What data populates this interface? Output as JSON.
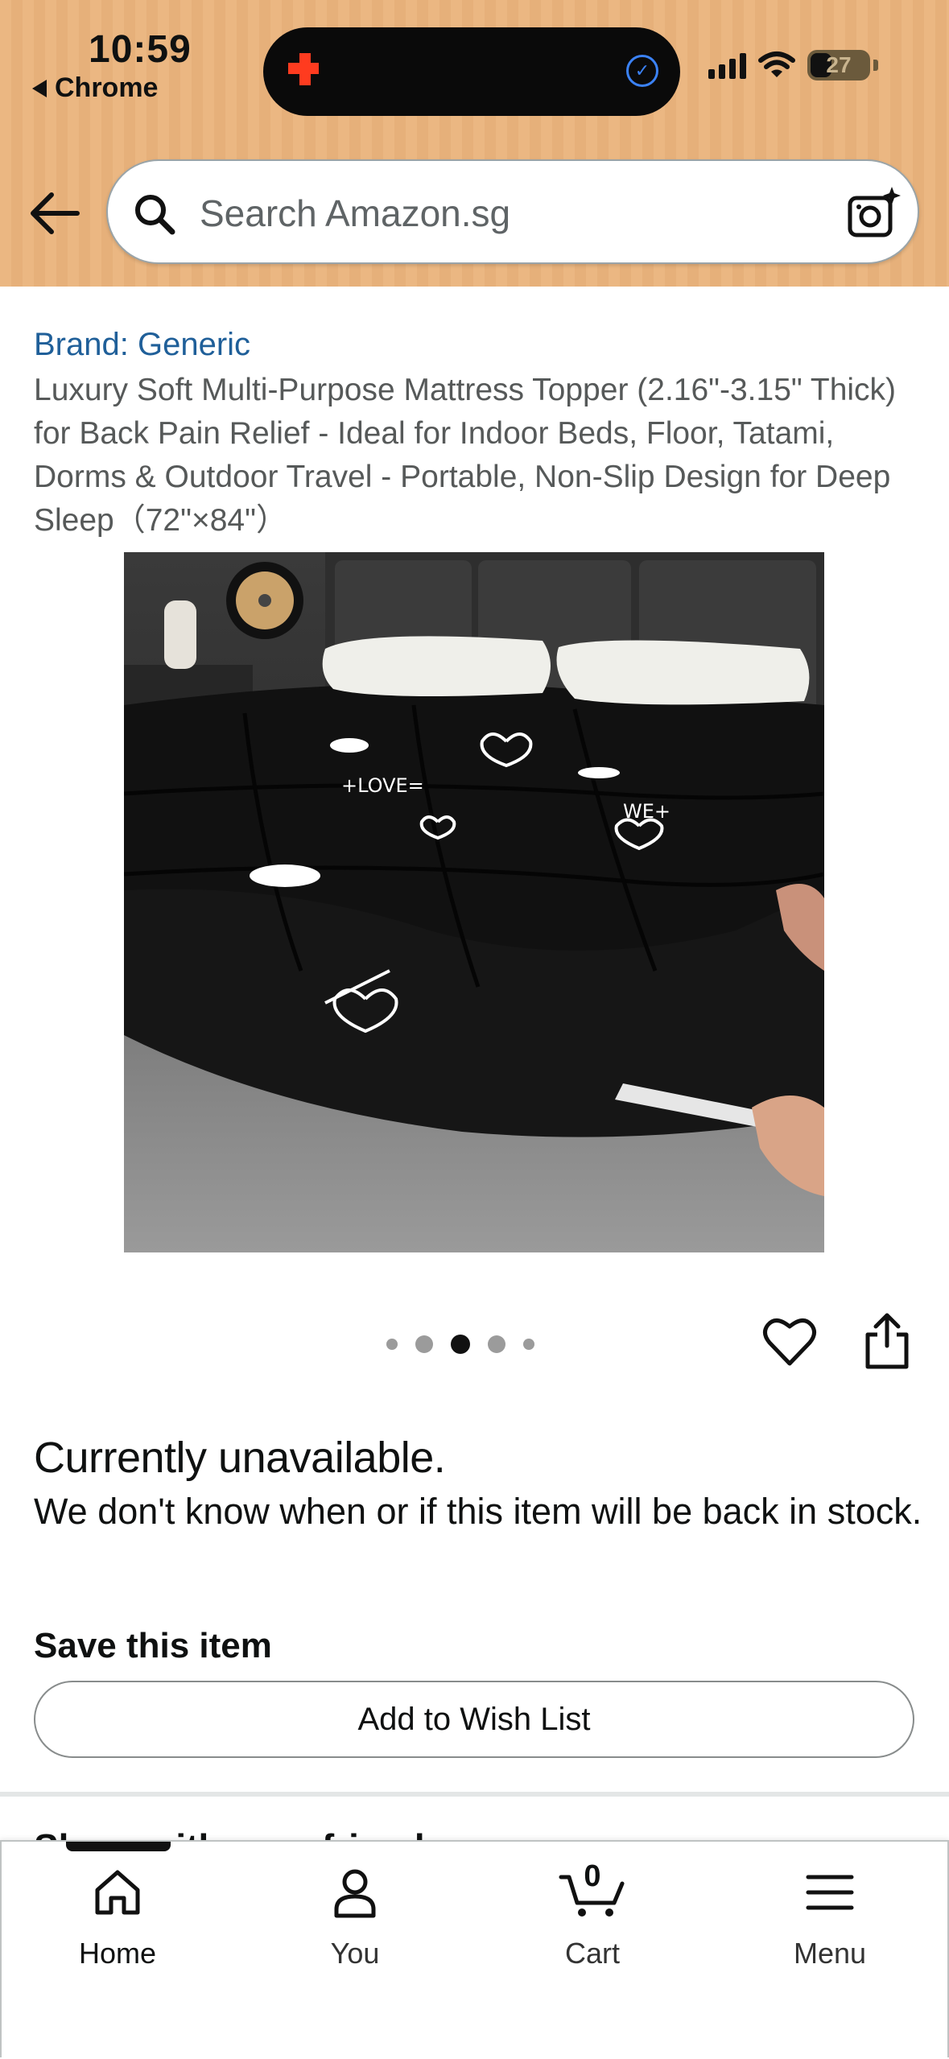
{
  "status_bar": {
    "time": "10:59",
    "back_app": "Chrome",
    "battery": "27"
  },
  "search": {
    "placeholder": "Search Amazon.sg"
  },
  "product": {
    "brand": "Brand: Generic",
    "title": "Luxury Soft Multi-Purpose Mattress Topper (2.16\"-3.15\" Thick) for Back Pain Relief - Ideal for Indoor Beds, Floor, Tatami, Dorms & Outdoor Travel - Portable, Non-Slip Design for Deep Sleep（72\"×84\"）",
    "image_text_1": "+LOVE=",
    "image_text_2": "WE+"
  },
  "gallery": {
    "dot_count": 5,
    "active_index": 2
  },
  "availability": {
    "heading": "Currently unavailable.",
    "message": "We don't know when or if this item will be back in stock."
  },
  "save": {
    "heading": "Save this item",
    "wish_list_label": "Add to Wish List"
  },
  "next_section_peek": "Share with your friends",
  "bottom_nav": {
    "home": "Home",
    "you": "You",
    "cart": "Cart",
    "cart_count": "0",
    "menu": "Menu"
  },
  "colors": {
    "header_bg": "#ebb782",
    "link_blue": "#1f5f99",
    "title_gray": "#565959"
  }
}
